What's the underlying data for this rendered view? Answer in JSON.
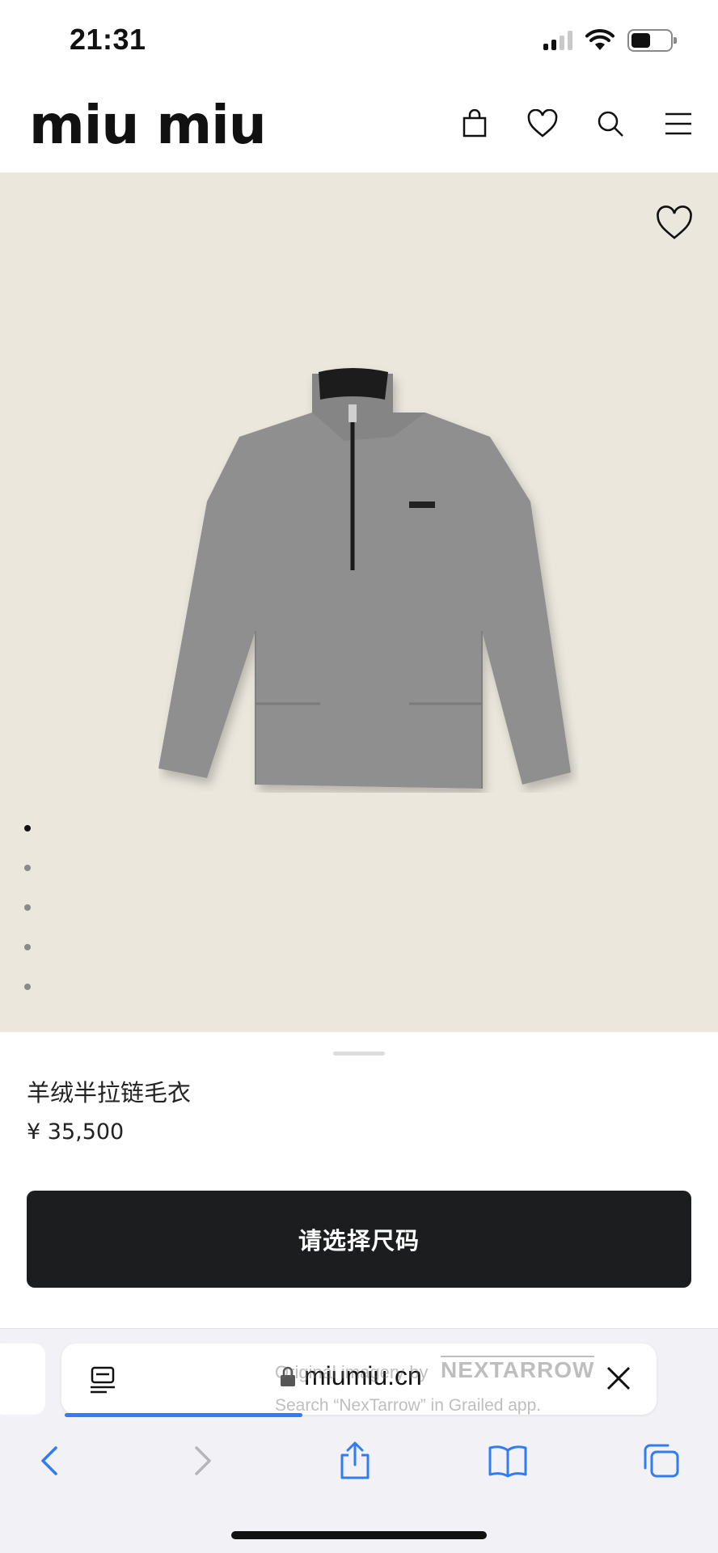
{
  "status_bar": {
    "time": "21:31",
    "icons": [
      "cellular-signal-icon",
      "wifi-icon",
      "battery-icon"
    ]
  },
  "header": {
    "logo_text": "miu miu",
    "icons": [
      "shopping-bag-icon",
      "wishlist-heart-icon",
      "search-icon",
      "menu-icon"
    ]
  },
  "product": {
    "image_subject": "grey cashmere half-zip sweater",
    "image_count": 5,
    "active_image_index": 0,
    "name": "羊绒半拉链毛衣",
    "price": "¥ 35,500",
    "select_size_label": "请选择尺码"
  },
  "browser": {
    "url": "miumiu.cn",
    "load_progress_fraction": 0.4,
    "toolbar": [
      "back-icon",
      "forward-icon",
      "share-icon",
      "bookmarks-icon",
      "tabs-icon"
    ]
  },
  "watermark": {
    "line1": "Original imagery by",
    "logo": "NEXTARROW",
    "line2": "Search “NexTarrow” in Grailed app."
  },
  "colors": {
    "image_background": "#ebe7dd",
    "button_background": "#1b1d1e",
    "progress_blue": "#2f7cf6",
    "browser_chrome": "#f2f2f6"
  }
}
